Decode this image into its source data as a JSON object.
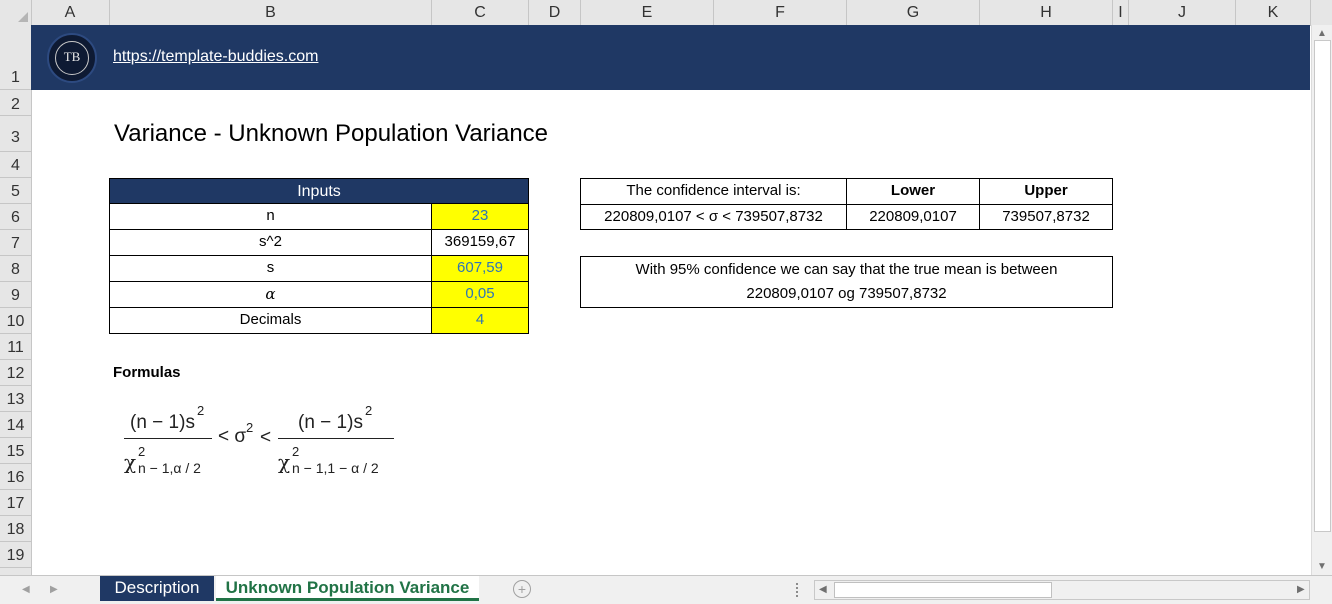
{
  "columns": [
    "A",
    "B",
    "C",
    "D",
    "E",
    "F",
    "G",
    "H",
    "I",
    "J",
    "K"
  ],
  "rows": [
    "1",
    "2",
    "3",
    "4",
    "5",
    "6",
    "7",
    "8",
    "9",
    "10",
    "11",
    "12",
    "13",
    "14",
    "15",
    "16",
    "17",
    "18",
    "19"
  ],
  "banner": {
    "logo_text": "TB",
    "link": "https://template-buddies.com"
  },
  "title": "Variance - Unknown Population Variance",
  "inputs": {
    "header": "Inputs",
    "rows": [
      {
        "label": "n",
        "value": "23"
      },
      {
        "label": "s^2",
        "value": "369159,67"
      },
      {
        "label": "s",
        "value": "607,59"
      },
      {
        "label": "α",
        "value": "0,05"
      },
      {
        "label": "Decimals",
        "value": "4"
      }
    ]
  },
  "ci": {
    "header": "The confidence interval is:",
    "lower_label": "Lower",
    "upper_label": "Upper",
    "expression": "220809,0107 < σ < 739507,8732",
    "lower": "220809,0107",
    "upper": "739507,8732"
  },
  "statement": {
    "line1": "With 95% confidence we can say that the true mean is between",
    "line2": "220809,0107 og 739507,8732"
  },
  "formulas_label": "Formulas",
  "formula": {
    "num": "(n − 1)s",
    "num_exp": "2",
    "chi": "χ",
    "chi_exp": "2",
    "sub_left": "n − 1,α / 2",
    "sub_right": "n − 1,1 − α / 2",
    "mid": "< σ",
    "mid_exp": "2",
    "lt": "<"
  },
  "tabs": [
    {
      "label": "Description",
      "active": false
    },
    {
      "label": "Unknown Population Variance",
      "active": true
    }
  ],
  "colors": {
    "navy": "#1f3864",
    "yellow": "#ffff00",
    "value_blue": "#2e75b6",
    "active_tab": "#217346"
  }
}
